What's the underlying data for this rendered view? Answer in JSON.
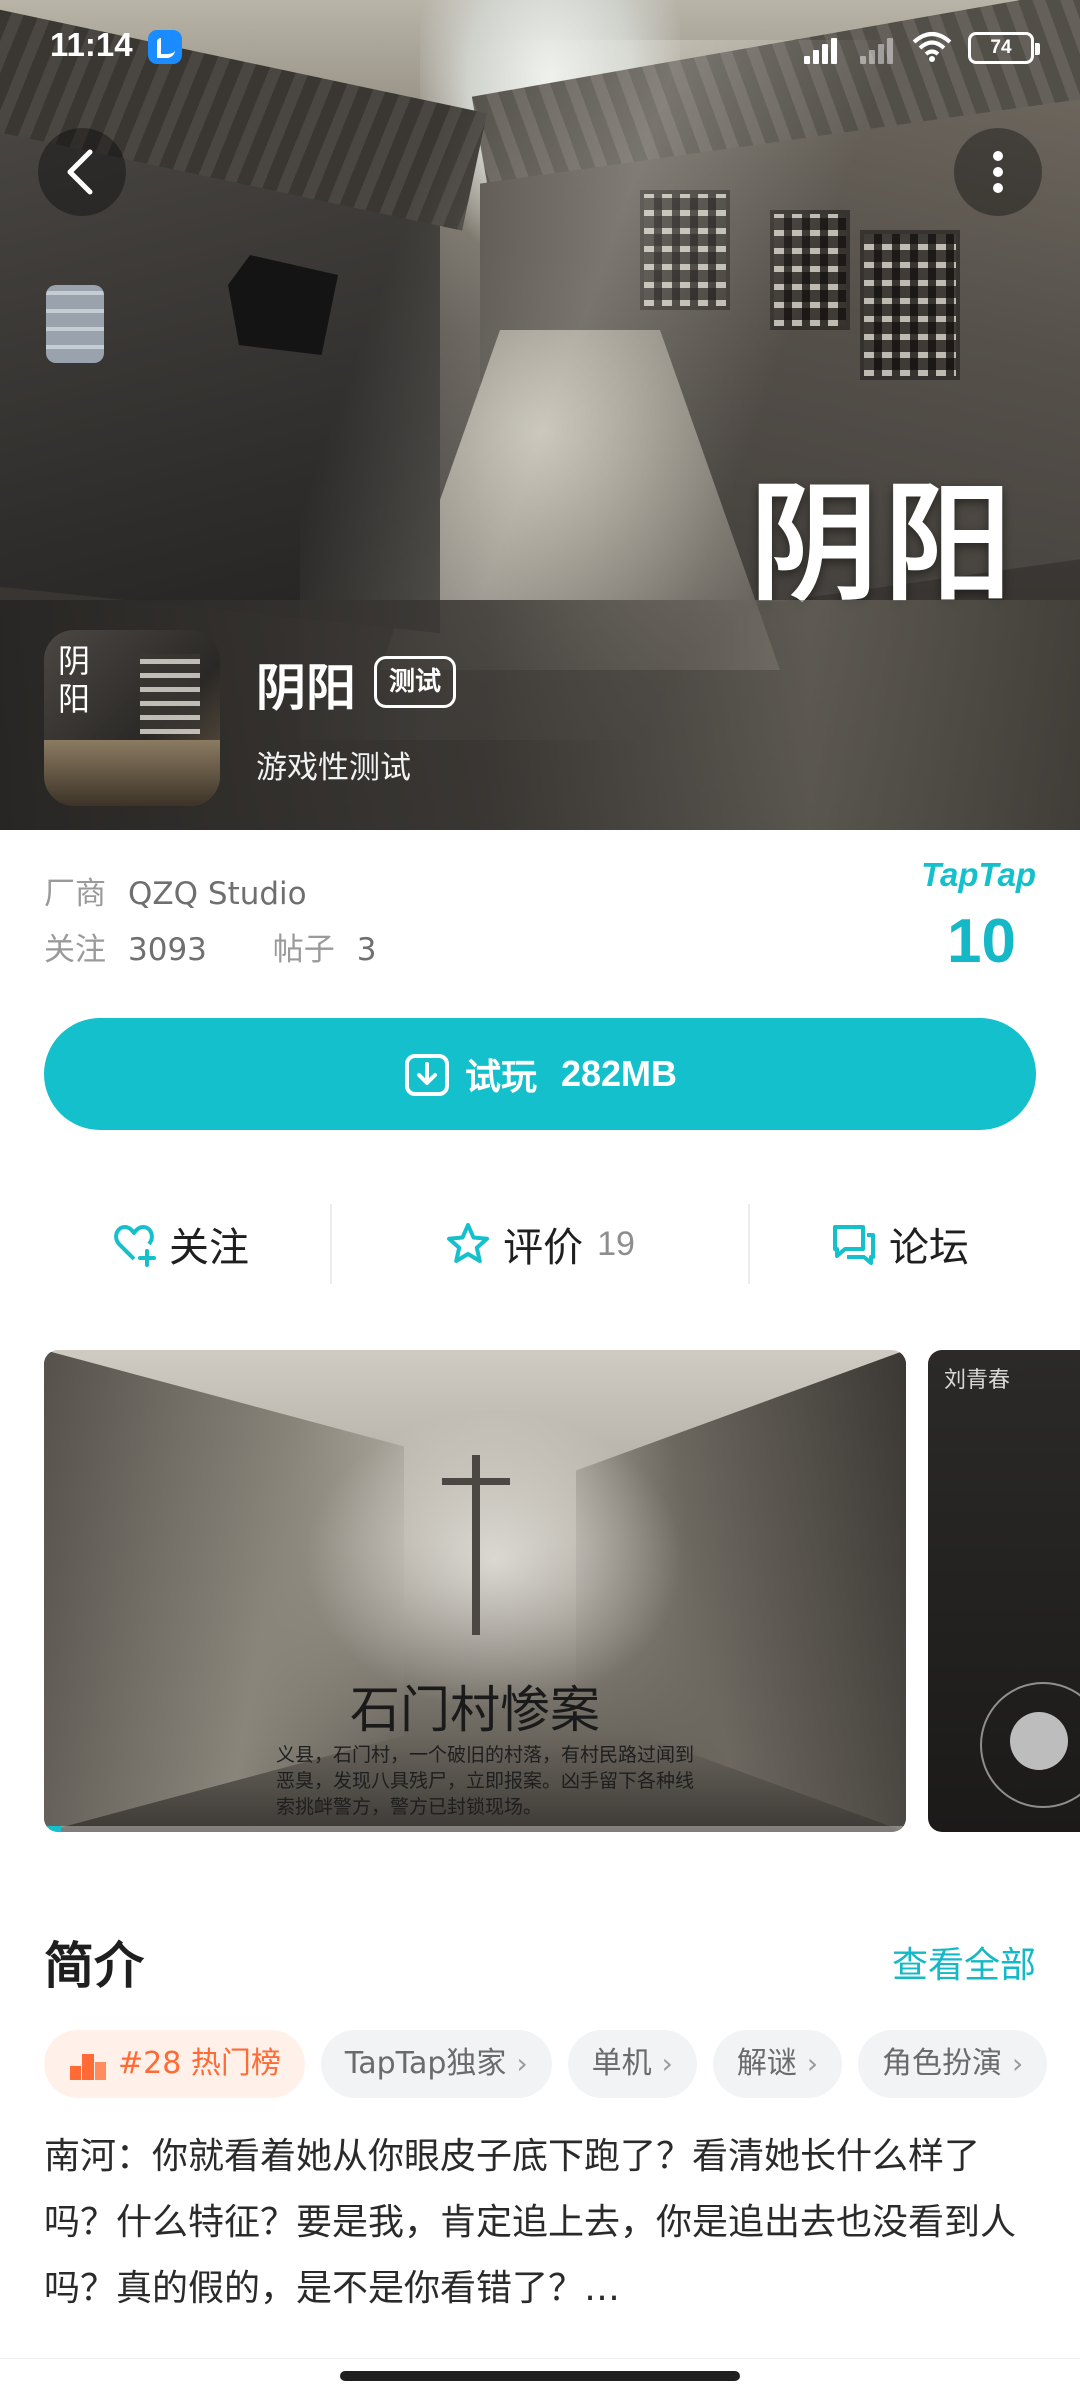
{
  "status_bar": {
    "time": "11:14",
    "battery": "74"
  },
  "hero": {
    "banner_title": "阴阳"
  },
  "game": {
    "icon_text": "阴阳",
    "title": "阴阳",
    "badge": "测试",
    "subtitle": "游戏性测试"
  },
  "info": {
    "vendor_label": "厂商",
    "vendor_value": "QZQ Studio",
    "follow_label": "关注",
    "follow_value": "3093",
    "posts_label": "帖子",
    "posts_value": "3",
    "brand": "TapTap",
    "rating": "10"
  },
  "play_button": {
    "label": "试玩",
    "size": "282MB"
  },
  "actions": {
    "follow": "关注",
    "review": "评价",
    "review_count": "19",
    "forum": "论坛"
  },
  "media": {
    "main_title": "石门村惨案",
    "main_desc": "义县，石门村，一个破旧的村落，有村民路过闻到恶臭，发现八具残尸，立即报案。凶手留下各种线索挑衅警方，警方已封锁现场。",
    "progress": 0.02,
    "side_tag": "刘青春"
  },
  "intro": {
    "title": "简介",
    "see_all": "查看全部",
    "tags": [
      {
        "label": "#28 热门榜",
        "hot": true
      },
      {
        "label": "TapTap独家",
        "hot": false
      },
      {
        "label": "单机",
        "hot": false
      },
      {
        "label": "解谜",
        "hot": false
      },
      {
        "label": "角色扮演",
        "hot": false
      }
    ],
    "text": "南河：你就看着她从你眼皮子底下跑了？看清她长什么样了吗？什么特征？要是我，肯定追上去，你是追出去也没看到人吗？真的假的，是不是你看错了？…"
  },
  "colors": {
    "accent": "#14c0cc",
    "hot": "#ff6a35"
  }
}
